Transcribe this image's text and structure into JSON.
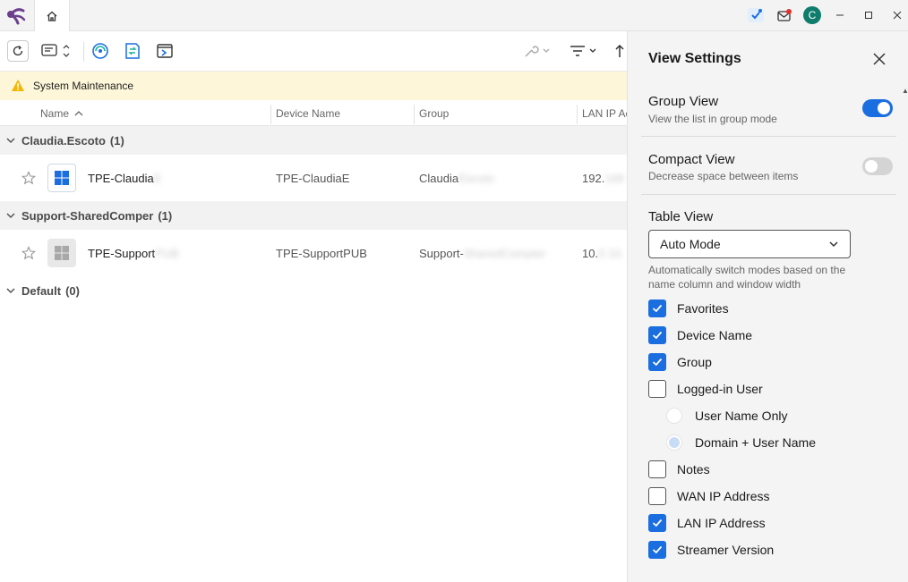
{
  "titlebar": {
    "avatar_letter": "C",
    "icons": [
      "app-logo-icon",
      "home-icon",
      "assistant-icon",
      "mail-alert-icon"
    ],
    "window_controls": [
      "minimize",
      "maximize",
      "close"
    ]
  },
  "toolbar": {
    "icons": [
      "refresh-icon",
      "view-mode-icon",
      "remote-control-icon",
      "file-transfer-icon",
      "backstage-icon",
      "tools-icon",
      "filter-icon",
      "sort-icon"
    ]
  },
  "banner": {
    "text": "System Maintenance"
  },
  "table": {
    "columns": [
      {
        "label": "Name",
        "sort": "asc"
      },
      {
        "label": "Device Name"
      },
      {
        "label": "Group"
      },
      {
        "label": "LAN IP Ac"
      }
    ],
    "groups": [
      {
        "name": "Claudia.Escoto",
        "count": "(1)",
        "devices": [
          {
            "name": "TPE-Claudia",
            "name_hidden": "E",
            "os": "windows",
            "device_name": "TPE-ClaudiaE",
            "group": "Claudia",
            "group_hidden": "Escoto",
            "lan_ip": "192.",
            "lan_ip_hidden": "168"
          }
        ]
      },
      {
        "name": "Support-SharedComper",
        "count": "(1)",
        "devices": [
          {
            "name": "TPE-Support",
            "name_hidden": "PUB",
            "os": "windows-offline",
            "device_name": "TPE-SupportPUB",
            "group": "Support-",
            "group_hidden": "SharedCompter",
            "lan_ip": "10.",
            "lan_ip_hidden": "0.10."
          }
        ]
      },
      {
        "name": "Default",
        "count": "(0)",
        "devices": []
      }
    ]
  },
  "panel": {
    "title": "View Settings",
    "group_view": {
      "title": "Group View",
      "desc": "View the list in group mode",
      "on": true
    },
    "compact_view": {
      "title": "Compact View",
      "desc": "Decrease space between items",
      "on": false
    },
    "table_view": {
      "title": "Table View",
      "mode": "Auto Mode",
      "note": "Automatically switch modes based on the name column and window width"
    },
    "columns": [
      {
        "label": "Favorites",
        "checked": true
      },
      {
        "label": "Device Name",
        "checked": true
      },
      {
        "label": "Group",
        "checked": true
      },
      {
        "label": "Logged-in User",
        "checked": false
      },
      {
        "label": "Notes",
        "checked": false
      },
      {
        "label": "WAN IP Address",
        "checked": false
      },
      {
        "label": "LAN IP Address",
        "checked": true
      },
      {
        "label": "Streamer Version",
        "checked": true
      }
    ],
    "user_options": [
      {
        "label": "User Name Only",
        "selected": false
      },
      {
        "label": "Domain + User Name",
        "selected": true
      }
    ]
  }
}
